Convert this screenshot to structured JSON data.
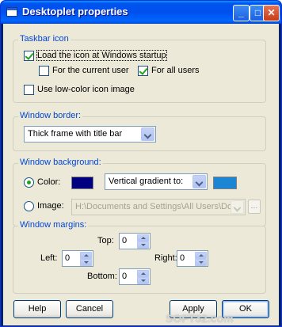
{
  "window": {
    "title": "Desktoplet properties",
    "controls": {
      "minimize": "_",
      "maximize": "□",
      "close": "✕"
    }
  },
  "taskbar_icon": {
    "legend": "Taskbar icon",
    "load_at_startup": {
      "label": "Load the icon at Windows startup",
      "checked": true
    },
    "for_current_user": {
      "label": "For the current user",
      "checked": false
    },
    "for_all_users": {
      "label": "For all users",
      "checked": true
    },
    "low_color": {
      "label": "Use low-color icon image",
      "checked": false
    }
  },
  "window_border": {
    "legend": "Window border:",
    "selected": "Thick frame with title bar"
  },
  "window_background": {
    "legend": "Window background:",
    "color_option": {
      "label": "Color:",
      "selected": true
    },
    "color1": "#000080",
    "gradient": "Vertical gradient to:",
    "color2": "#1c86d4",
    "image_option": {
      "label": "Image:",
      "selected": false
    },
    "image_path": "H:\\Documents and Settings\\All Users\\Do",
    "browse": "..."
  },
  "window_margins": {
    "legend": "Window margins:",
    "top_label": "Top:",
    "top_value": "0",
    "left_label": "Left:",
    "left_value": "0",
    "right_label": "Right:",
    "right_value": "0",
    "bottom_label": "Bottom:",
    "bottom_value": "0"
  },
  "buttons": {
    "help": "Help",
    "cancel": "Cancel",
    "apply": "Apply",
    "ok": "OK"
  },
  "watermark": "SOFT32.com"
}
